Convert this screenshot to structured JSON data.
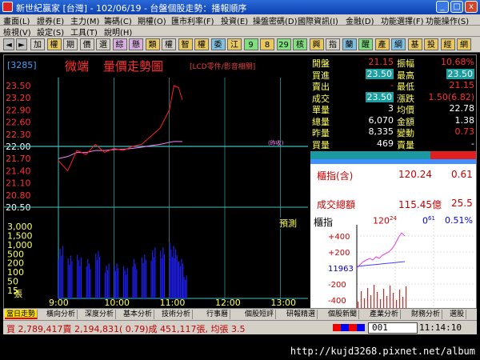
{
  "window": {
    "title": "新世紀贏家 [台灣] - 102/06/19 - 台盤個股走勢：播報順序",
    "min_label": "_",
    "max_label": "□",
    "close_label": "x"
  },
  "menu": {
    "row1": [
      "畫面(L)",
      "證券(E)",
      "主力(M)",
      "籌碼(C)",
      "期權(O)",
      "匯市利率(F)",
      "投資(E)",
      "操盤密碼(D)",
      "國際資訊(I)",
      "金融(D)",
      "功能選擇(F)",
      "功能操作(S)"
    ],
    "row2": [
      "檢視(V)",
      "設定(S)",
      "工具(T)",
      "說明(H)"
    ]
  },
  "toolbar": {
    "items": [
      "加",
      "權",
      "期",
      "價",
      "選",
      "綜",
      "懸",
      "類",
      "權",
      "智",
      "權",
      "委",
      "江",
      "9",
      "8",
      "29",
      "核",
      "興",
      "指",
      "蘭",
      "醒",
      "產",
      "綱",
      "基",
      "投",
      "經",
      "網"
    ],
    "colors": [
      "#d4d0c8",
      "#e8c860",
      "#d4d0c8",
      "#d4d0c8",
      "#d4d0c8",
      "#d8b0e0",
      "#d8b0e0",
      "#e8c860",
      "#d4d0c8",
      "#e8c860",
      "#e8c860",
      "#80c0e0",
      "#e8c860",
      "#80e080",
      "#e8c860",
      "#80e080",
      "#80e080",
      "#e8c860",
      "#d4d0c8",
      "#80c0e0",
      "#80e080",
      "#e8c860",
      "#80c0e0",
      "#e8c860",
      "#e8c860",
      "#e8c860",
      "#e8c860"
    ]
  },
  "stock": {
    "code": "[3285]",
    "name": "微端",
    "chart_title": "量價走勢圖",
    "subtitle": "[LCD零件/影音相關]",
    "ref_tag": "(昨收)",
    "forecast_label": "預測"
  },
  "quote": {
    "rows": [
      [
        {
          "label": "開盤",
          "value": "21.15"
        },
        {
          "label": "振幅",
          "value": "10.68%"
        }
      ],
      [
        {
          "label": "買進",
          "value": "23.50"
        },
        {
          "label": "最高",
          "value": "23.50"
        }
      ],
      [
        {
          "label": "賣出",
          "value": "-"
        },
        {
          "label": "最低",
          "value": "21.15"
        }
      ],
      [
        {
          "label": "成交",
          "value": "23.50"
        },
        {
          "label": "漲跌",
          "value": "1.50(6.82)"
        }
      ],
      [
        {
          "label": "單量",
          "value": "3"
        },
        {
          "label": "均價",
          "value": "22.78"
        }
      ],
      [
        {
          "label": "總量",
          "value": "6,070"
        },
        {
          "label": "金額",
          "value": "1.38"
        }
      ],
      [
        {
          "label": "昨量",
          "value": "8,335"
        },
        {
          "label": "變動",
          "value": "0.73"
        }
      ],
      [
        {
          "label": "買量",
          "value": "469"
        },
        {
          "label": "賣量",
          "value": "-"
        }
      ]
    ]
  },
  "index_box": {
    "label": "櫃指(含)",
    "value": "120.24",
    "change": "0.61",
    "turnover_label": "成交總額",
    "turnover_value": "115.45億",
    "turnover_change": "25.5"
  },
  "mini_chart": {
    "title": "櫃指",
    "value_main": "120",
    "value_sub": "24",
    "change_main": "0",
    "change_sub": "61",
    "percent": "0.51%",
    "ylabels": [
      "+400",
      "+200",
      "11963",
      "-200",
      "-400"
    ]
  },
  "chart_data": {
    "type": "line",
    "x": [
      "9:00",
      "9:10",
      "9:20",
      "9:30",
      "9:40",
      "9:50",
      "10:00",
      "10:10",
      "10:20",
      "10:30",
      "10:40",
      "10:50",
      "11:00",
      "11:05",
      "11:10",
      "11:14"
    ],
    "series": [
      {
        "values": [
          21.65,
          21.4,
          21.9,
          21.8,
          22.05,
          21.85,
          21.95,
          21.9,
          22.0,
          22.05,
          22.25,
          22.45,
          22.9,
          23.5,
          23.45,
          23.15
        ]
      },
      {
        "values": [
          21.7,
          21.75,
          21.85,
          21.85,
          21.9,
          21.9,
          21.92,
          21.93,
          21.95,
          21.98,
          22.02,
          22.05,
          22.1,
          22.12,
          22.12,
          22.12
        ]
      }
    ],
    "volume_values": [
      1600,
      1200,
      1100,
      900,
      1300,
      700,
      800,
      600,
      900,
      1100,
      1500,
      1700,
      1800,
      1400,
      900,
      300
    ],
    "yticks": [
      "23.50",
      "23.20",
      "22.90",
      "22.60",
      "22.30",
      "22.00",
      "21.70",
      "21.40",
      "21.10",
      "20.80",
      "20.50"
    ],
    "vol_ticks": [
      "3,000",
      "1,500",
      "1,000",
      "500",
      "200",
      "100",
      "50",
      "15"
    ],
    "vol_unit": "張",
    "xticks": [
      "9:00",
      "10:00",
      "11:00",
      "12:00",
      "13:00"
    ],
    "reference": 22.0,
    "ylim": [
      20.5,
      23.5
    ],
    "colors": {
      "price": "#ff2020",
      "average": "#ff80ff",
      "volume": "#2020ff",
      "reference": "#40c0c0"
    }
  },
  "tabs": [
    "當日走勢",
    "橫向分析",
    "深度分析",
    "基本分析",
    "技術分析",
    "行事曆",
    "個股短評",
    "研報精選",
    "個股新聞",
    "產業分析",
    "財務分析",
    "選股"
  ],
  "status": {
    "text": "買 2,789,417賣 2,194,831( 0.79)成 451,117張, 均張 3.5",
    "code": "001",
    "time": "11:14:10"
  },
  "footer": {
    "url": "http://kujd3268.pixnet.net/album"
  }
}
